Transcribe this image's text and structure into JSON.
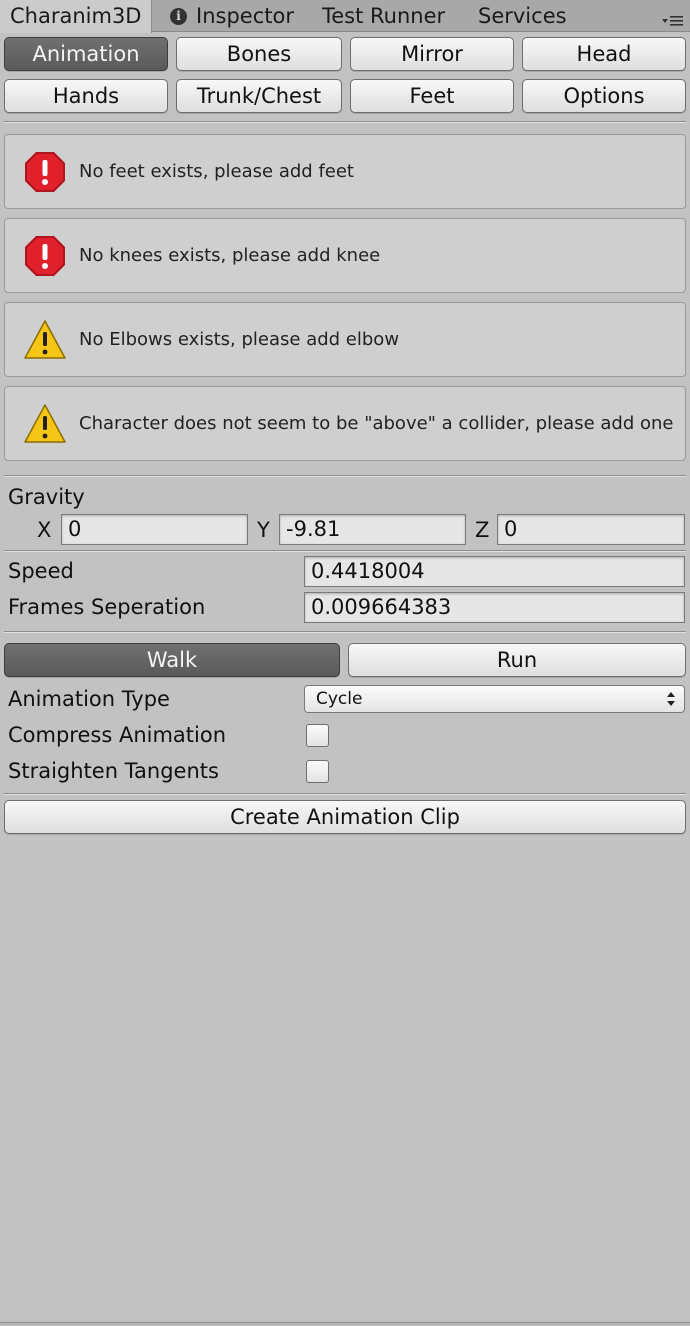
{
  "tabs": {
    "active": "Charanim3D",
    "inspector": "Inspector",
    "test_runner": "Test Runner",
    "services": "Services"
  },
  "nav_buttons": {
    "animation": "Animation",
    "bones": "Bones",
    "mirror": "Mirror",
    "head": "Head",
    "hands": "Hands",
    "trunk_chest": "Trunk/Chest",
    "feet": "Feet",
    "options": "Options",
    "active": "Animation"
  },
  "messages": [
    {
      "type": "error",
      "icon": "error-icon",
      "text": "No feet exists, please add feet"
    },
    {
      "type": "error",
      "icon": "error-icon",
      "text": "No knees exists, please add knee"
    },
    {
      "type": "warning",
      "icon": "warning-icon",
      "text": "No Elbows exists, please add elbow"
    },
    {
      "type": "warning",
      "icon": "warning-icon",
      "text": "Character does not seem to be \"above\" a collider, please add one"
    }
  ],
  "gravity": {
    "label": "Gravity",
    "x_label": "X",
    "x": "0",
    "y_label": "Y",
    "y": "-9.81",
    "z_label": "Z",
    "z": "0"
  },
  "speed": {
    "label": "Speed",
    "value": "0.4418004"
  },
  "frames": {
    "label": "Frames Seperation",
    "value": "0.009664383"
  },
  "mode": {
    "walk": "Walk",
    "run": "Run",
    "active": "Walk"
  },
  "animation_type": {
    "label": "Animation Type",
    "value": "Cycle"
  },
  "compress": {
    "label": "Compress Animation",
    "checked": false
  },
  "straighten": {
    "label": "Straighten Tangents",
    "checked": false
  },
  "create_button": "Create Animation Clip",
  "colors": {
    "error": "#e0202a",
    "warning": "#f5c518",
    "active_button": "#666666",
    "background": "#c2c2c2"
  }
}
